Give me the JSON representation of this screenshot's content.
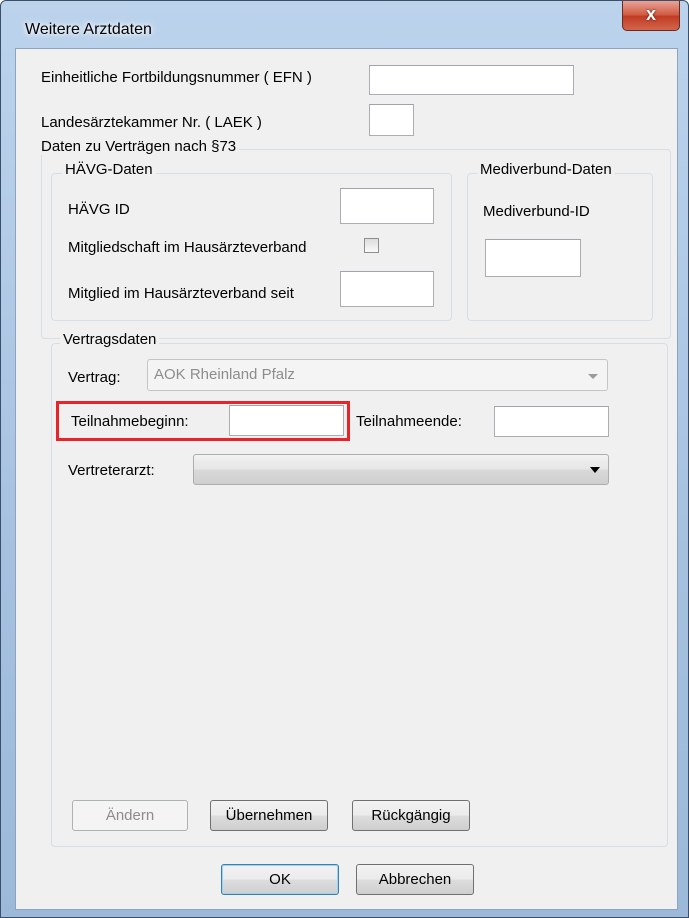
{
  "window": {
    "title": "Weitere Arztdaten",
    "close_label": "x"
  },
  "fields": {
    "efn_label": "Einheitliche Fortbildungsnummer ( EFN )",
    "efn_value": "",
    "laek_label": "Landesärztekammer Nr. ( LAEK )",
    "laek_value": ""
  },
  "vertraege_group": {
    "title": "Daten zu Verträgen nach §73"
  },
  "haevg_group": {
    "title": "HÄVG-Daten",
    "id_label": "HÄVG ID",
    "id_value": "",
    "membership_label": "Mitgliedschaft im Hausärzteverband",
    "membership_checked": false,
    "member_since_label": "Mitglied im Hausärzteverband seit",
    "member_since_value": ""
  },
  "mediverbund_group": {
    "title": "Mediverbund-Daten",
    "id_label": "Mediverbund-ID",
    "id_value": ""
  },
  "vertragsdaten_group": {
    "title": "Vertragsdaten",
    "vertrag_label": "Vertrag:",
    "vertrag_value": "AOK Rheinland Pfalz",
    "teilnahmebeginn_label": "Teilnahmebeginn:",
    "teilnahmebeginn_value": "",
    "teilnahmeende_label": "Teilnahmeende:",
    "teilnahmeende_value": "",
    "vertreterarzt_label": "Vertreterarzt:",
    "vertreterarzt_value": ""
  },
  "buttons": {
    "aendern": "Ändern",
    "uebernehmen": "Übernehmen",
    "rueckgaengig": "Rückgängig",
    "ok": "OK",
    "abbrechen": "Abbrechen"
  },
  "colors": {
    "highlight": "#e8232a",
    "window_frame": "#a6c1e0",
    "client_bg": "#f0f0f0",
    "close_button": "#c13a22"
  }
}
